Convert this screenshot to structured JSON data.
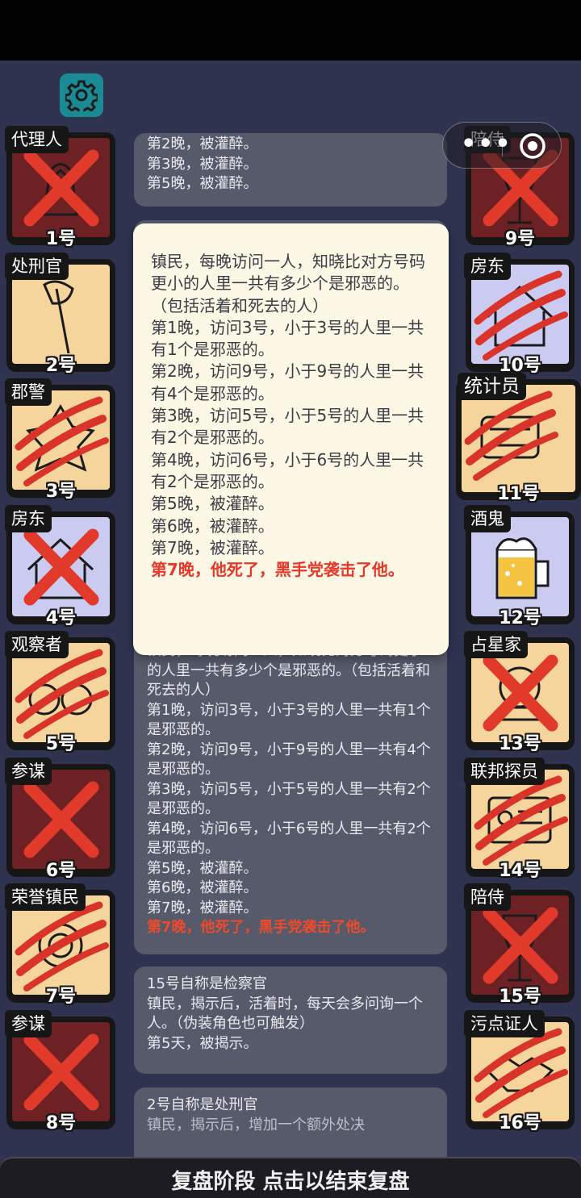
{
  "settings_icon": "gear-icon",
  "capsule": {
    "menu_icon": "more-dots-icon",
    "close_icon": "target-close-icon"
  },
  "left_players": [
    {
      "role": "代理人",
      "number": "1号",
      "type": "evil",
      "state": "crossed",
      "art": "coat-icon"
    },
    {
      "role": "处刑官",
      "number": "2号",
      "type": "good",
      "state": "alive",
      "art": "axe-icon"
    },
    {
      "role": "郡警",
      "number": "3号",
      "type": "good",
      "state": "clawed",
      "art": "badge-icon"
    },
    {
      "role": "房东",
      "number": "4号",
      "type": "outsider",
      "state": "crossed",
      "art": "house-icon"
    },
    {
      "role": "观察者",
      "number": "5号",
      "type": "good",
      "state": "clawed",
      "art": "binoculars-icon"
    },
    {
      "role": "参谋",
      "number": "6号",
      "type": "evil",
      "state": "crossed",
      "art": "none"
    },
    {
      "role": "荣誉镇民",
      "number": "7号",
      "type": "good",
      "state": "clawed",
      "art": "medal-icon"
    },
    {
      "role": "参谋",
      "number": "8号",
      "type": "evil",
      "state": "crossed",
      "art": "none"
    }
  ],
  "right_players": [
    {
      "role": "陪侍",
      "number": "9号",
      "type": "evil",
      "state": "crossed",
      "art": "glass-icon"
    },
    {
      "role": "房东",
      "number": "10号",
      "type": "outsider",
      "state": "clawed",
      "art": "house-icon"
    },
    {
      "role": "统计员",
      "number": "11号",
      "type": "good",
      "state": "clawed",
      "art": "abacus-icon"
    },
    {
      "role": "酒鬼",
      "number": "12号",
      "type": "outsider",
      "state": "alive",
      "art": "beer-icon"
    },
    {
      "role": "占星家",
      "number": "13号",
      "type": "good",
      "state": "crossed",
      "art": "crystal-icon"
    },
    {
      "role": "联邦探员",
      "number": "14号",
      "type": "good",
      "state": "clawed",
      "art": "id-card-icon"
    },
    {
      "role": "陪侍",
      "number": "15号",
      "type": "evil",
      "state": "crossed",
      "art": "glass-icon"
    },
    {
      "role": "污点证人",
      "number": "16号",
      "type": "good",
      "state": "clawed",
      "art": "handshake-icon"
    }
  ],
  "log": {
    "top_lines": [
      "第2晚，被灌醉。",
      "第3晚，被灌醉。",
      "第5晚，被灌醉。"
    ],
    "main_lines": [
      "镇民，每晚访问一人，知晓比对方号码更小的人里一共有多少个是邪恶的。（包括活着和死去的人）",
      "第1晚，访问3号，小于3号的人里一共有1个是邪恶的。",
      "第2晚，访问9号，小于9号的人里一共有4个是邪恶的。",
      "第3晚，访问5号，小于5号的人里一共有2个是邪恶的。",
      "第4晚，访问6号，小于6号的人里一共有2个是邪恶的。",
      "第5晚，被灌醉。",
      "第6晚，被灌醉。",
      "第7晚，被灌醉。"
    ],
    "main_death": "第7晚，他死了，黑手党袭击了他。",
    "entry15": [
      "15号自称是检察官",
      "镇民，揭示后，活着时，每天会多问询一个人。（伪装角色也可触发）",
      "第5天，被揭示。"
    ],
    "entry2_title": "2号自称是处刑官",
    "entry2_cut": "镇民，揭示后，增加一个额外处决"
  },
  "popup": {
    "lines": [
      "镇民，每晚访问一人，知晓比对方号码更小的人里一共有多少个是邪恶的。（包括活着和死去的人）",
      "第1晚，访问3号，小于3号的人里一共有1个是邪恶的。",
      "第2晚，访问9号，小于9号的人里一共有4个是邪恶的。",
      "第3晚，访问5号，小于5号的人里一共有2个是邪恶的。",
      "第4晚，访问6号，小于6号的人里一共有2个是邪恶的。",
      "第5晚，被灌醉。",
      "第6晚，被灌醉。",
      "第7晚，被灌醉。"
    ],
    "death": "第7晚，他死了，黑手党袭击了他。"
  },
  "bottom_bar": {
    "label": "复盘阶段 点击以结束复盘"
  }
}
